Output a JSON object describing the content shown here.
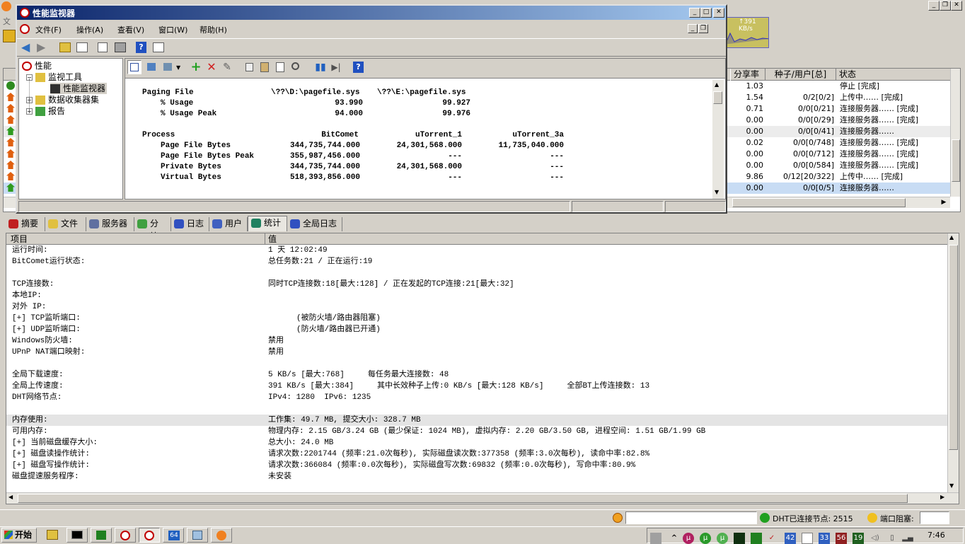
{
  "bitcomet": {
    "title_left": "文",
    "torrent_columns": {
      "share": "分享率",
      "seeds": "种子/用户[总]",
      "status": "状态"
    },
    "torrents": [
      {
        "share": "1.03",
        "seeds": "",
        "status": "停止 [完成]",
        "color": "#2e8b20"
      },
      {
        "share": "1.54",
        "seeds": "0/2[0/2]",
        "status": "上传中…… [完成]",
        "color": "#e06010"
      },
      {
        "share": "0.71",
        "seeds": "0/0[0/21]",
        "status": "连接服务器…… [完成]",
        "color": "#e06010"
      },
      {
        "share": "0.00",
        "seeds": "0/0[0/29]",
        "status": "连接服务器…… [完成]",
        "color": "#e06010"
      },
      {
        "share": "0.00",
        "seeds": "0/0[0/41]",
        "status": "连接服务器……",
        "color": "#2e9b20"
      },
      {
        "share": "0.02",
        "seeds": "0/0[0/748]",
        "status": "连接服务器…… [完成]",
        "color": "#e06010"
      },
      {
        "share": "0.00",
        "seeds": "0/0[0/712]",
        "status": "连接服务器…… [完成]",
        "color": "#e06010"
      },
      {
        "share": "0.00",
        "seeds": "0/0[0/584]",
        "status": "连接服务器…… [完成]",
        "color": "#e06010"
      },
      {
        "share": "9.86",
        "seeds": "0/12[20/322]",
        "status": "上传中…… [完成]",
        "color": "#e06010"
      },
      {
        "share": "0.00",
        "seeds": "0/0[0/5]",
        "status": "连接服务器……",
        "color": "#2e9b20"
      }
    ],
    "speed_graph_label": "↑391 KB/s",
    "tabs": [
      {
        "label": "摘要",
        "icon": "summary-icon",
        "color": "#c02020"
      },
      {
        "label": "文件",
        "icon": "file-icon",
        "color": "#e0c040"
      },
      {
        "label": "服务器",
        "icon": "server-icon",
        "color": "#6070a0"
      },
      {
        "label": "分块",
        "icon": "pie-icon",
        "color": "#40a040"
      },
      {
        "label": "日志",
        "icon": "info-icon",
        "color": "#3050c0"
      },
      {
        "label": "用户",
        "icon": "user-icon",
        "color": "#4060c0"
      },
      {
        "label": "统计",
        "icon": "stats-icon",
        "color": "#208060"
      },
      {
        "label": "全局日志",
        "icon": "info-icon",
        "color": "#3050c0"
      }
    ],
    "active_tab": "统计",
    "stats_columns": {
      "item": "项目",
      "value": "值"
    },
    "stats": [
      {
        "item": "运行时间:",
        "value": "1 天 12:02:49"
      },
      {
        "item": "BitComet运行状态:",
        "value": "总任务数:21 / 正在运行:19"
      },
      {
        "item": "",
        "value": ""
      },
      {
        "item": "TCP连接数:",
        "value": "同时TCP连接数:18[最大:128] / 正在发起的TCP连接:21[最大:32]"
      },
      {
        "item": "本地IP:",
        "value": ""
      },
      {
        "item": "对外 IP:",
        "value": ""
      },
      {
        "item": "[+] TCP监听端口:",
        "value": "(被防火墙/路由器阻塞)"
      },
      {
        "item": "[+] UDP监听端口:",
        "value": "(防火墙/路由器已开通)"
      },
      {
        "item": "Windows防火墙:",
        "value": "禁用"
      },
      {
        "item": "UPnP NAT端口映射:",
        "value": "禁用"
      },
      {
        "item": "",
        "value": ""
      },
      {
        "item": "全局下载速度:",
        "value": "5 KB/s [最大:768]     每任务最大连接数: 48"
      },
      {
        "item": "全局上传速度:",
        "value": "391 KB/s [最大:384]     其中长效种子上传:0 KB/s [最大:128 KB/s]     全部BT上传连接数: 13"
      },
      {
        "item": "DHT网络节点:",
        "value": "IPv4: 1280  IPv6: 1235"
      },
      {
        "item": "",
        "value": ""
      },
      {
        "item": "内存使用:",
        "value": "工作集: 49.7 MB, 提交大小: 328.7 MB"
      },
      {
        "item": "可用内存:",
        "value": "物理内存: 2.15 GB/3.24 GB (最少保证: 1024 MB), 虚拟内存: 2.20 GB/3.50 GB, 进程空间: 1.51 GB/1.99 GB"
      },
      {
        "item": "[+] 当前磁盘缓存大小:",
        "value": "总大小: 24.0 MB"
      },
      {
        "item": "[+] 磁盘读操作统计:",
        "value": "请求次数:2201744 (频率:21.0次每秒), 实际磁盘读次数:377358 (频率:3.0次每秒), 读命中率:82.8%"
      },
      {
        "item": "[+] 磁盘写操作统计:",
        "value": "请求次数:366084 (频率:0.0次每秒), 实际磁盘写次数:69832 (频率:0.0次每秒), 写命中率:80.9%"
      },
      {
        "item": "磁盘提速服务程序:",
        "value": "未安装"
      }
    ],
    "statusbar": {
      "dht": "DHT已连接节点: 2515",
      "port": "端口阻塞:"
    }
  },
  "perfmon": {
    "title": "性能监视器",
    "menu": [
      "文件(F)",
      "操作(A)",
      "查看(V)",
      "窗口(W)",
      "帮助(H)"
    ],
    "tree": [
      {
        "label": "性能",
        "icon": "perf-icon"
      },
      {
        "label": "监视工具",
        "icon": "folder-icon"
      },
      {
        "label": "性能监视器",
        "icon": "monitor-icon"
      },
      {
        "label": "数据收集器集",
        "icon": "folder-icon"
      },
      {
        "label": "报告",
        "icon": "report-icon"
      }
    ],
    "report": {
      "paging_section": "Paging File",
      "paging_instances": [
        "\\??\\D:\\pagefile.sys",
        "\\??\\E:\\pagefile.sys"
      ],
      "paging_rows": [
        {
          "label": "% Usage",
          "values": [
            "93.990",
            "99.927"
          ]
        },
        {
          "label": "% Usage Peak",
          "values": [
            "94.000",
            "99.976"
          ]
        }
      ],
      "process_section": "Process",
      "process_instances": [
        "BitComet",
        "uTorrent_1",
        "uTorrent_3a"
      ],
      "process_rows": [
        {
          "label": "Page File Bytes",
          "values": [
            "344,735,744.000",
            "24,301,568.000",
            "11,735,040.000"
          ]
        },
        {
          "label": "Page File Bytes Peak",
          "values": [
            "355,987,456.000",
            "---",
            "---"
          ]
        },
        {
          "label": "Private Bytes",
          "values": [
            "344,735,744.000",
            "24,301,568.000",
            "---"
          ]
        },
        {
          "label": "Virtual Bytes",
          "values": [
            "518,393,856.000",
            "---",
            "---"
          ]
        }
      ]
    }
  },
  "taskbar": {
    "start": "开始",
    "tray_numbers": [
      "42",
      "33",
      "56",
      "19"
    ],
    "clock": "7:46"
  }
}
